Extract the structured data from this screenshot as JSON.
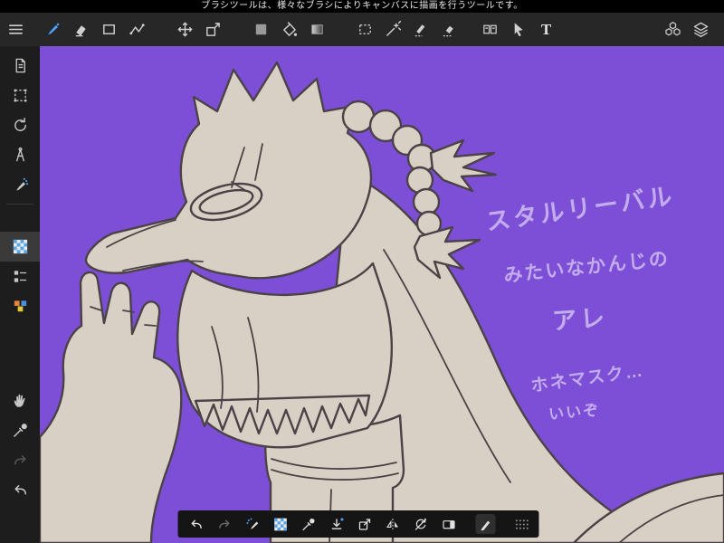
{
  "message_bar": {
    "text": "ブラシツールは、様々なブラシによりキャンバスに描画を行うツールです。"
  },
  "toolbar": {
    "text_tool_label": "T",
    "active_tool": "brush",
    "tools": [
      "menu",
      "brush",
      "eraser",
      "rectangle",
      "polyline",
      "move",
      "transform",
      "fill-square",
      "paint-bucket",
      "gradient",
      "select-marquee",
      "magic-wand",
      "select-pen",
      "select-eraser",
      "panels",
      "cursor",
      "text",
      "materials",
      "layers"
    ]
  },
  "sidebar": {
    "tools": [
      "page",
      "select-area",
      "rotate-view",
      "divider",
      "airbrush",
      "pattern-swatch",
      "layer-list",
      "palette",
      "hand",
      "eyedropper",
      "redo",
      "undo"
    ],
    "selected_tool": "pattern-swatch",
    "disabled_tools": [
      "redo"
    ]
  },
  "canvas": {
    "annotations": [
      {
        "text": "スタルリーバル"
      },
      {
        "text": "みたいなかんじの"
      },
      {
        "text": "アレ"
      },
      {
        "text": "ホネマスク…"
      },
      {
        "text": "いいぞ"
      }
    ]
  },
  "bottom_toolbar": {
    "tools": [
      "undo",
      "redo",
      "brush-spray",
      "pattern-swatch",
      "eyedropper",
      "save",
      "export",
      "flip-horizontal",
      "rotate-reset",
      "split-view",
      "pen",
      "drag-handle"
    ]
  },
  "colors": {
    "canvas_background": "#7d4fd6",
    "figure_fill": "#d9d0c5",
    "figure_line": "#4b4247",
    "annotation_text": "#c9b4f0",
    "accent_blue": "#4da3ff",
    "toolbar_background": "#272727",
    "message_bar_background": "#000000"
  }
}
